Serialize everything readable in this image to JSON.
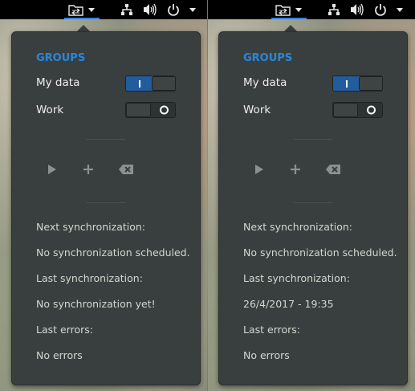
{
  "panels": [
    {
      "groups_title": "GROUPS",
      "rows": [
        {
          "label": "My data",
          "state": "on"
        },
        {
          "label": "Work",
          "state": "off"
        }
      ],
      "next_sync_label": "Next synchronization:",
      "next_sync_value": "No synchronization scheduled.",
      "last_sync_label": "Last synchronization:",
      "last_sync_value": "No synchronization yet!",
      "last_errors_label": "Last errors:",
      "last_errors_value": "No errors"
    },
    {
      "groups_title": "GROUPS",
      "rows": [
        {
          "label": "My data",
          "state": "on"
        },
        {
          "label": "Work",
          "state": "off"
        }
      ],
      "next_sync_label": "Next synchronization:",
      "next_sync_value": "No synchronization scheduled.",
      "last_sync_label": "Last synchronization:",
      "last_sync_value": "26/4/2017 - 19:35",
      "last_errors_label": "Last errors:",
      "last_errors_value": "No errors"
    }
  ],
  "topbar": {
    "icons": [
      "sync-extension-icon",
      "network-icon",
      "volume-icon",
      "power-icon"
    ],
    "accent_color": "#3b7fd6"
  },
  "actions": {
    "icons": [
      "play-icon",
      "add-icon",
      "delete-icon"
    ]
  },
  "colors": {
    "accent": "#2a87d8",
    "switch_on": "#215d9c",
    "panel_bg": "#393f3f"
  }
}
